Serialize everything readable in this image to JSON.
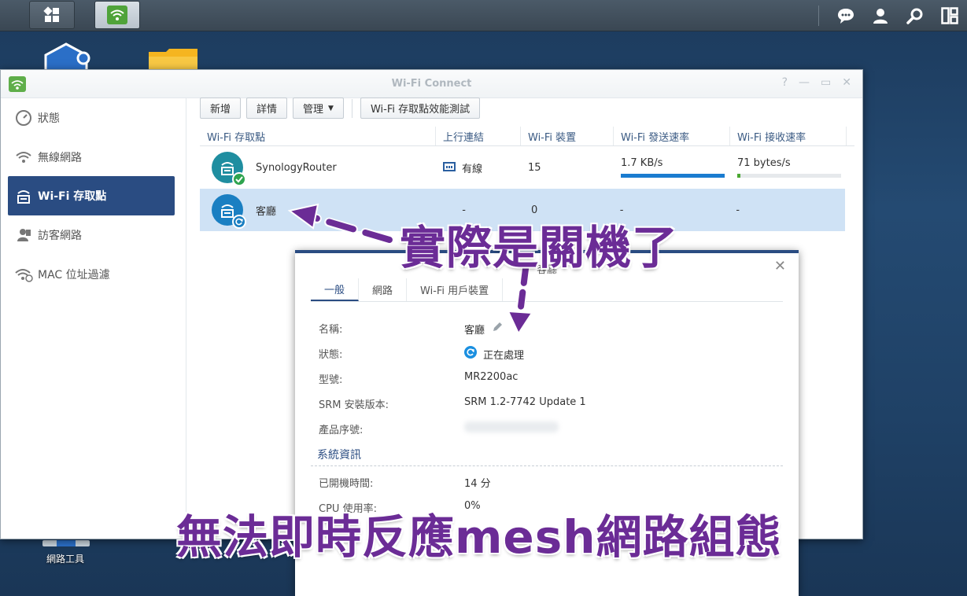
{
  "taskbar": {
    "icons": [
      "main-menu-icon",
      "wifi-connect-app-icon",
      "chat-icon",
      "user-icon",
      "search-icon",
      "widgets-icon"
    ]
  },
  "desktop": {
    "network_tool_label": "網路工具"
  },
  "window": {
    "title": "Wi-Fi Connect",
    "controls": [
      "?",
      "—",
      "▭",
      "✕"
    ],
    "sidebar": [
      {
        "label": "狀態",
        "icon": "gauge-icon",
        "active": false
      },
      {
        "label": "無線網路",
        "icon": "wifi-icon",
        "active": false
      },
      {
        "label": "Wi-Fi 存取點",
        "icon": "access-point-icon",
        "active": true
      },
      {
        "label": "訪客網路",
        "icon": "guest-icon",
        "active": false
      },
      {
        "label": "MAC 位址過濾",
        "icon": "wifi-filter-icon",
        "active": false
      }
    ],
    "toolbar": {
      "add": "新增",
      "details": "詳情",
      "manage": "管理",
      "speed_test": "Wi-Fi 存取點效能測試"
    },
    "grid": {
      "columns": [
        "Wi-Fi 存取點",
        "上行連結",
        "Wi-Fi 裝置",
        "Wi-Fi 發送速率",
        "Wi-Fi 接收速率"
      ],
      "rows": [
        {
          "name": "SynologyRouter",
          "uplink": "有線",
          "devices": "15",
          "tx": "1.7 KB/s",
          "rx": "71 bytes/s",
          "tx_fill": 1.0,
          "rx_fill": 0.03,
          "status": "ok",
          "selected": false
        },
        {
          "name": "客廳",
          "uplink": "-",
          "devices": "0",
          "tx": "-",
          "rx": "-",
          "status": "processing",
          "selected": true
        }
      ]
    }
  },
  "panel": {
    "title": "客廳",
    "tabs": [
      "一般",
      "網路",
      "Wi-Fi 用戶裝置"
    ],
    "props": {
      "name_label": "名稱:",
      "name_value": "客廳",
      "status_label": "狀態:",
      "status_value": "正在處理",
      "model_label": "型號:",
      "model_value": "MR2200ac",
      "srm_label": "SRM 安裝版本:",
      "srm_value": "SRM 1.2-7742 Update 1",
      "serial_label": "產品序號:"
    },
    "system_section": "系統資訊",
    "uptime_label": "已開機時間:",
    "uptime_value": "14 分",
    "cpu_label": "CPU 使用率:",
    "cpu_value": "0%"
  },
  "annotations": {
    "top": "實際是關機了",
    "bottom": "無法即時反應mesh網路組態",
    "color": "#6b2c96"
  }
}
